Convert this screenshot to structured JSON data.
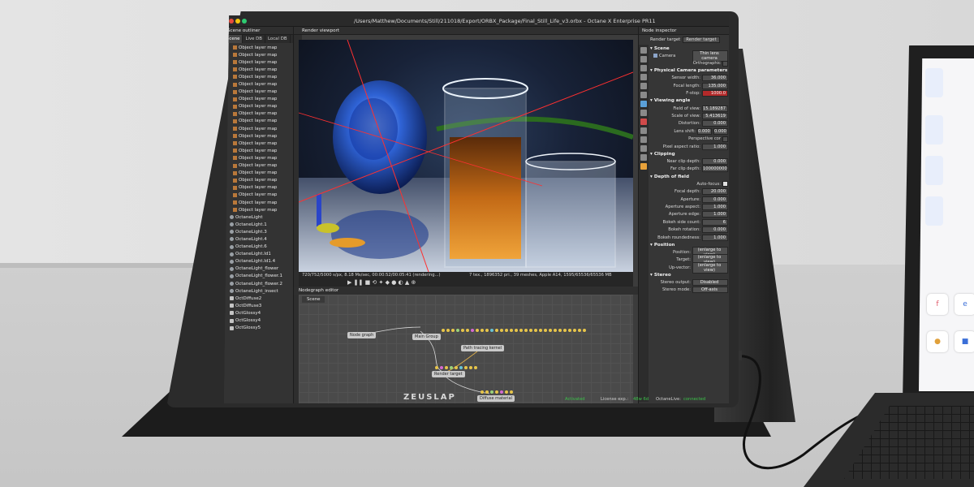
{
  "window": {
    "title": "/Users/Matthew/Documents/Still/211018/Export/ORBX_Package/Final_Still_Life_v3.orbx - Octane X Enterprise PR11"
  },
  "device": {
    "brand": "ZEUSLAP"
  },
  "outliner": {
    "title": "Scene outliner",
    "tabs": [
      "Scene",
      "Live DB",
      "Local DB"
    ],
    "items": [
      "Object layer map",
      "Object layer map",
      "Object layer map",
      "Object layer map",
      "Object layer map",
      "Object layer map",
      "Object layer map",
      "Object layer map",
      "Object layer map",
      "Object layer map",
      "Object layer map",
      "Object layer map",
      "Object layer map",
      "Object layer map",
      "Object layer map",
      "Object layer map",
      "Object layer map",
      "Object layer map",
      "Object layer map",
      "Object layer map",
      "Object layer map",
      "Object layer map",
      "Object layer map",
      "OctaneLight",
      "OctaneLight.1",
      "OctaneLight.3",
      "OctaneLight.4",
      "OctaneLight.6",
      "OctaneLight.Id1",
      "OctaneLight.Id1.4",
      "OctaneLight_flower",
      "OctaneLight_flower.1",
      "OctaneLight_flower.2",
      "OctaneLight_insect",
      "OctDiffuse2",
      "OctDiffuse3",
      "OctGlossy4",
      "OctGlossy4",
      "OctGlossy5"
    ]
  },
  "viewport": {
    "title": "Render viewport",
    "stats_left": "720/752/5000 s/px, 8.18 Ms/sec, 00:00:52/00:05:41 (rendering...)",
    "stats_right": "7 tex., 1896352 pri., 39 meshes, Apple A14, 1595/65536/65536 MB"
  },
  "nodegraph": {
    "title": "Nodegraph editor",
    "tab": "Scene",
    "nodes": {
      "node_graph": "Node graph",
      "main_group": "Main Group",
      "kernel": "Path tracing kernel",
      "render_target": "Render target",
      "diffuse": "Diffuse material"
    }
  },
  "inspector": {
    "title": "Node inspector",
    "render_target_label": "Render target",
    "render_target_value": "Render target",
    "scene": "Scene",
    "camera_label": "Camera",
    "camera_value": "Thin lens camera",
    "orthographic": "Orthographic",
    "physical_camera": "Physical Camera parameters",
    "sensor_width_label": "Sensor width:",
    "sensor_width": "36.000",
    "focal_length_label": "Focal length:",
    "focal_length": "135.000",
    "fstop_label": "F-stop:",
    "fstop": "1000.0",
    "viewing_angle": "Viewing angle",
    "fov_label": "Field of view:",
    "fov": "15.189287",
    "scale_label": "Scale of view:",
    "scale": "5.413619",
    "distortion_label": "Distortion:",
    "distortion": "0.000",
    "lens_shift_label": "Lens shift:",
    "lens_shift_a": "0.000",
    "lens_shift_b": "0.000",
    "perspective_label": "Perspective cor",
    "pixel_aspect_label": "Pixel aspect ratio:",
    "pixel_aspect": "1.000",
    "clipping": "Clipping",
    "near_label": "Near clip depth:",
    "near": "0.000",
    "far_label": "Far clip depth:",
    "far": "100000000",
    "dof": "Depth of field",
    "autofocus_label": "Auto-focus:",
    "focal_depth_label": "Focal depth:",
    "focal_depth": "20.000",
    "aperture_label": "Aperture:",
    "aperture": "0.000",
    "aperture_aspect_label": "Aperture aspect:",
    "aperture_aspect": "1.000",
    "aperture_edge_label": "Aperture edge:",
    "aperture_edge": "1.000",
    "bokeh_count_label": "Bokeh side count:",
    "bokeh_count": "6",
    "bokeh_rot_label": "Bokeh rotation:",
    "bokeh_rot": "0.000",
    "bokeh_round_label": "Bokeh roundedness:",
    "bokeh_round": "1.000",
    "position_sec": "Position",
    "position_label": "Position:",
    "position_val": "(enlarge to view)",
    "target_label": "Target:",
    "target_val": "(enlarge to view)",
    "up_label": "Up-vector:",
    "up_val": "(enlarge to view)",
    "stereo": "Stereo",
    "stereo_output_label": "Stereo output:",
    "stereo_output": "Disabled",
    "stereo_mode_label": "Stereo mode:",
    "stereo_mode": "Off-axis"
  },
  "status": {
    "activated": "Activated",
    "license": "License exp.:",
    "license_val": "48w 6d",
    "octanelive": "OctaneLive:",
    "octanelive_val": "connected"
  },
  "colors": {
    "accent": "#e8a23a",
    "status_ok": "#3cc24a",
    "fstop_red": "#b42a2a"
  }
}
